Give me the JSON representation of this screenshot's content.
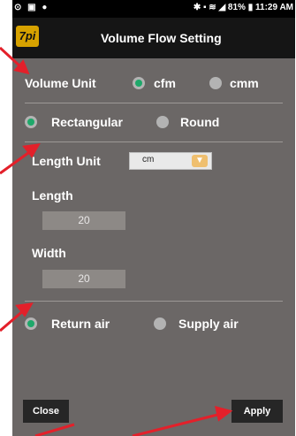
{
  "statusbar": {
    "left_icons": "⊙ ▣ ●",
    "right_text": "✱ ▪ ≋ ◢ 81% ▮ 11:29 AM"
  },
  "appbar": {
    "logo_text": "7pi",
    "title": "Volume Flow Setting"
  },
  "volume_unit": {
    "label": "Volume Unit",
    "options": [
      "cfm",
      "cmm"
    ],
    "selected": "cfm"
  },
  "shape": {
    "options": [
      "Rectangular",
      "Round"
    ],
    "selected": "Rectangular"
  },
  "length_unit": {
    "label": "Length Unit",
    "value": "cm"
  },
  "length": {
    "label": "Length",
    "value": "20"
  },
  "width": {
    "label": "Width",
    "value": "20"
  },
  "air": {
    "options": [
      "Return air",
      "Supply air"
    ],
    "selected": "Return air"
  },
  "buttons": {
    "close": "Close",
    "apply": "Apply"
  },
  "colors": {
    "background": "#6b6766",
    "radio_selected": "#1ea86a",
    "annotation_arrow": "#e3202a"
  }
}
